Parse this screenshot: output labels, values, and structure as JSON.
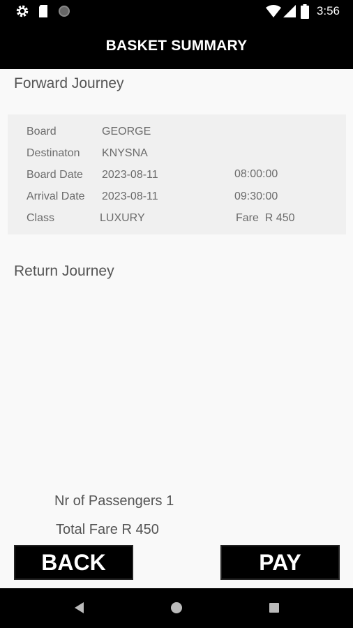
{
  "status_bar": {
    "time": "3:56",
    "icons_left": [
      "gear-icon",
      "sd-card-icon",
      "circle-icon"
    ],
    "icons_right": [
      "wifi-icon",
      "signal-icon",
      "battery-icon"
    ]
  },
  "header": {
    "title": "BASKET SUMMARY"
  },
  "forward": {
    "title": "Forward Journey",
    "board_label": "Board",
    "board_value": "GEORGE",
    "destination_label": "Destinaton",
    "destination_value": "KNYSNA",
    "board_date_label": "Board Date",
    "board_date_value": "2023-08-11",
    "board_time": "08:00:00",
    "arrival_date_label": "Arrival Date",
    "arrival_date_value": "2023-08-11",
    "arrival_time": "09:30:00",
    "class_label": "Class",
    "class_value": "LUXURY",
    "fare": "Fare  R 450"
  },
  "return": {
    "title": "Return Journey"
  },
  "summary": {
    "passengers": "Nr of Passengers 1",
    "total_fare": "Total Fare R 450"
  },
  "buttons": {
    "back": "BACK",
    "pay": "PAY"
  },
  "nav": {
    "icons": [
      "back-icon",
      "home-icon",
      "recents-icon"
    ]
  },
  "colors": {
    "bar": "#000000",
    "background": "#f9f9f9",
    "card": "#f0f0f0"
  }
}
